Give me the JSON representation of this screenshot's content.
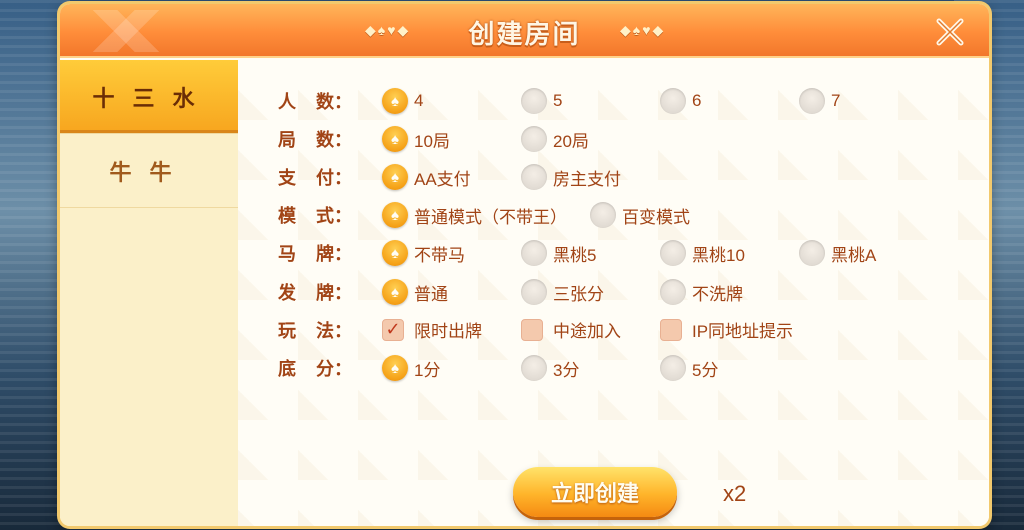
{
  "dialog": {
    "title": "创建房间",
    "title_deco_left": "◆♠♥◆",
    "title_deco_right": "◆♠♥◆"
  },
  "tabs": [
    {
      "label": "十三水",
      "active": true
    },
    {
      "label": "牛牛",
      "active": false
    }
  ],
  "rows": [
    {
      "label": [
        "人",
        "数："
      ],
      "type": "radio",
      "options": [
        "4",
        "5",
        "6",
        "7"
      ],
      "selected": 0
    },
    {
      "label": [
        "局",
        "数："
      ],
      "type": "radio",
      "options": [
        "10局",
        "20局"
      ],
      "selected": 0
    },
    {
      "label": [
        "支",
        "付："
      ],
      "type": "radio",
      "options": [
        "AA支付",
        "房主支付"
      ],
      "selected": 0
    },
    {
      "label": [
        "模",
        "式："
      ],
      "type": "radio",
      "options": [
        "普通模式（不带王）",
        "百变模式"
      ],
      "selected": 0
    },
    {
      "label": [
        "马",
        "牌："
      ],
      "type": "radio",
      "options": [
        "不带马",
        "黑桃5",
        "黑桃10",
        "黑桃A"
      ],
      "selected": 0
    },
    {
      "label": [
        "发",
        "牌："
      ],
      "type": "radio",
      "options": [
        "普通",
        "三张分",
        "不洗牌"
      ],
      "selected": 0
    },
    {
      "label": [
        "玩",
        "法："
      ],
      "type": "check",
      "options": [
        "限时出牌",
        "中途加入",
        "IP同地址提示"
      ],
      "checked": [
        true,
        false,
        false
      ]
    },
    {
      "label": [
        "底",
        "分："
      ],
      "type": "radio",
      "options": [
        "1分",
        "3分",
        "5分"
      ],
      "selected": 0
    }
  ],
  "create_button": "立即创建",
  "cost_multiplier": "x2",
  "colors": {
    "header": "#ff8d3a",
    "accent": "#f5a117",
    "label_text": "#a14416"
  },
  "icons": {
    "close": "close-x-icon",
    "radio_selected": "spade-icon",
    "checkbox_checked": "checkmark-icon"
  }
}
